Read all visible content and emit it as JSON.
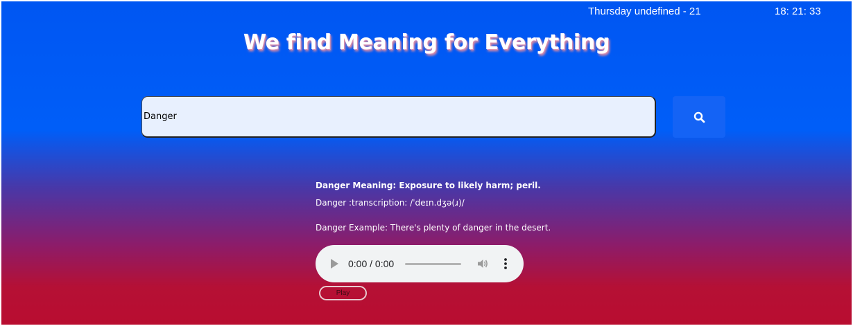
{
  "header": {
    "date": "Thursday undefined - 21",
    "time": "18: 21: 33",
    "title": "We find Meaning for Everything"
  },
  "search": {
    "value": "Danger",
    "button_icon": "search-icon"
  },
  "result": {
    "meaning": "Danger Meaning: Exposure to likely harm; peril.",
    "transcription": "Danger :transcription: /ˈdeɪn.dʒə(ɹ)/",
    "example": "Danger Example: There's plenty of danger in the desert."
  },
  "audio": {
    "time": "0:00 / 0:00",
    "play_icon": "play-icon",
    "volume_icon": "volume-icon",
    "more_icon": "more-vertical-icon"
  },
  "play_button": {
    "label": "Play"
  },
  "colors": {
    "gradient_top": "#0056f2",
    "gradient_bottom": "#b90d30",
    "search_button": "#1463f5",
    "input_bg": "#e8f0fe"
  }
}
